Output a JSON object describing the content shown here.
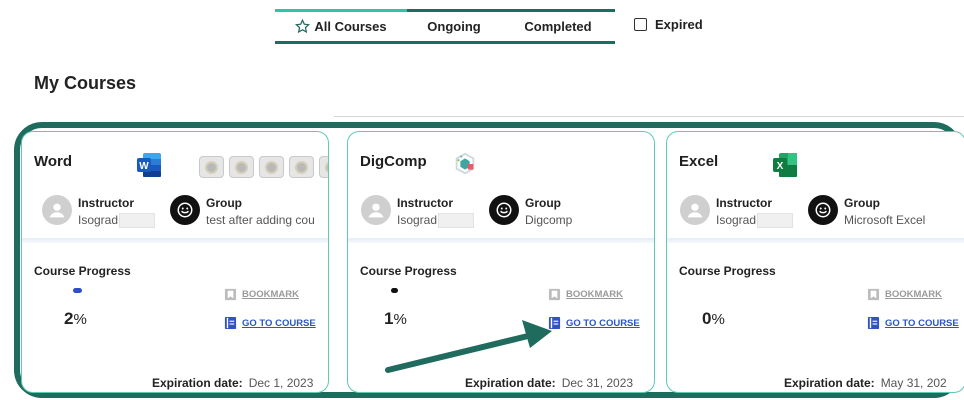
{
  "tabs": {
    "all": "All Courses",
    "ongoing": "Ongoing",
    "completed": "Completed",
    "expired": "Expired"
  },
  "section_title": "My Courses",
  "labels": {
    "instructor": "Instructor",
    "group": "Group",
    "course_progress": "Course Progress",
    "bookmark": "BOOKMARK",
    "go_to_course": "GO TO COURSE",
    "expiration": "Expiration date:"
  },
  "courses": [
    {
      "title": "Word",
      "app_icon": "word-icon",
      "instructor": "Isograd",
      "group": "test after adding cou",
      "progress_value": "2",
      "progress_unit": "%",
      "progress_fraction": 0.02,
      "bar_color": "#2f4fc6",
      "expiration": "Dec 1, 2023",
      "badges": 5
    },
    {
      "title": "DigComp",
      "app_icon": "digcomp-icon",
      "instructor": "Isograd",
      "group": "Digcomp",
      "progress_value": "1",
      "progress_unit": "%",
      "progress_fraction": 0.01,
      "bar_color": "#111111",
      "expiration": "Dec 31, 2023"
    },
    {
      "title": "Excel",
      "app_icon": "excel-icon",
      "instructor": "Isograd",
      "group": "Microsoft Excel",
      "progress_value": "0",
      "progress_unit": "%",
      "progress_fraction": 0.0,
      "expiration": "May 31, 202"
    }
  ],
  "colors": {
    "accent": "#2ec4a6",
    "dark_teal": "#1f6b5e",
    "link_blue": "#2f52c7"
  }
}
